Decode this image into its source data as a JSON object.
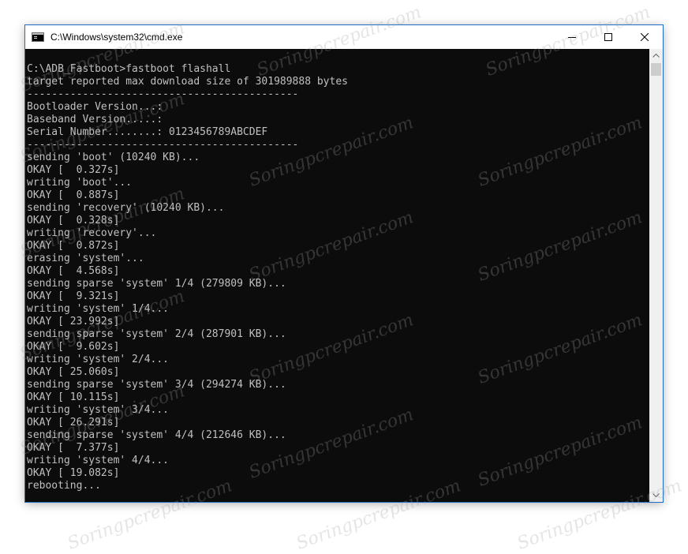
{
  "window": {
    "title": "C:\\Windows\\system32\\cmd.exe"
  },
  "console": {
    "lines": [
      "C:\\ADB_Fastboot>fastboot flashall",
      "target reported max download size of 301989888 bytes",
      "--------------------------------------------",
      "Bootloader Version...:",
      "Baseband Version.....:",
      "Serial Number........: 0123456789ABCDEF",
      "--------------------------------------------",
      "sending 'boot' (10240 KB)...",
      "OKAY [  0.327s]",
      "writing 'boot'...",
      "OKAY [  0.887s]",
      "sending 'recovery' (10240 KB)...",
      "OKAY [  0.328s]",
      "writing 'recovery'...",
      "OKAY [  0.872s]",
      "erasing 'system'...",
      "OKAY [  4.568s]",
      "sending sparse 'system' 1/4 (279809 KB)...",
      "OKAY [  9.321s]",
      "writing 'system' 1/4...",
      "OKAY [ 23.992s]",
      "sending sparse 'system' 2/4 (287901 KB)...",
      "OKAY [  9.602s]",
      "writing 'system' 2/4...",
      "OKAY [ 25.060s]",
      "sending sparse 'system' 3/4 (294274 KB)...",
      "OKAY [ 10.115s]",
      "writing 'system' 3/4...",
      "OKAY [ 26.291s]",
      "sending sparse 'system' 4/4 (212646 KB)...",
      "OKAY [  7.377s]",
      "writing 'system' 4/4...",
      "OKAY [ 19.082s]",
      "rebooting..."
    ]
  },
  "watermark": {
    "text": "Soringpcrepair.com"
  },
  "icons": {
    "app": "cmd-icon",
    "minimize": "minimize-icon",
    "maximize": "maximize-icon",
    "close": "close-icon"
  }
}
